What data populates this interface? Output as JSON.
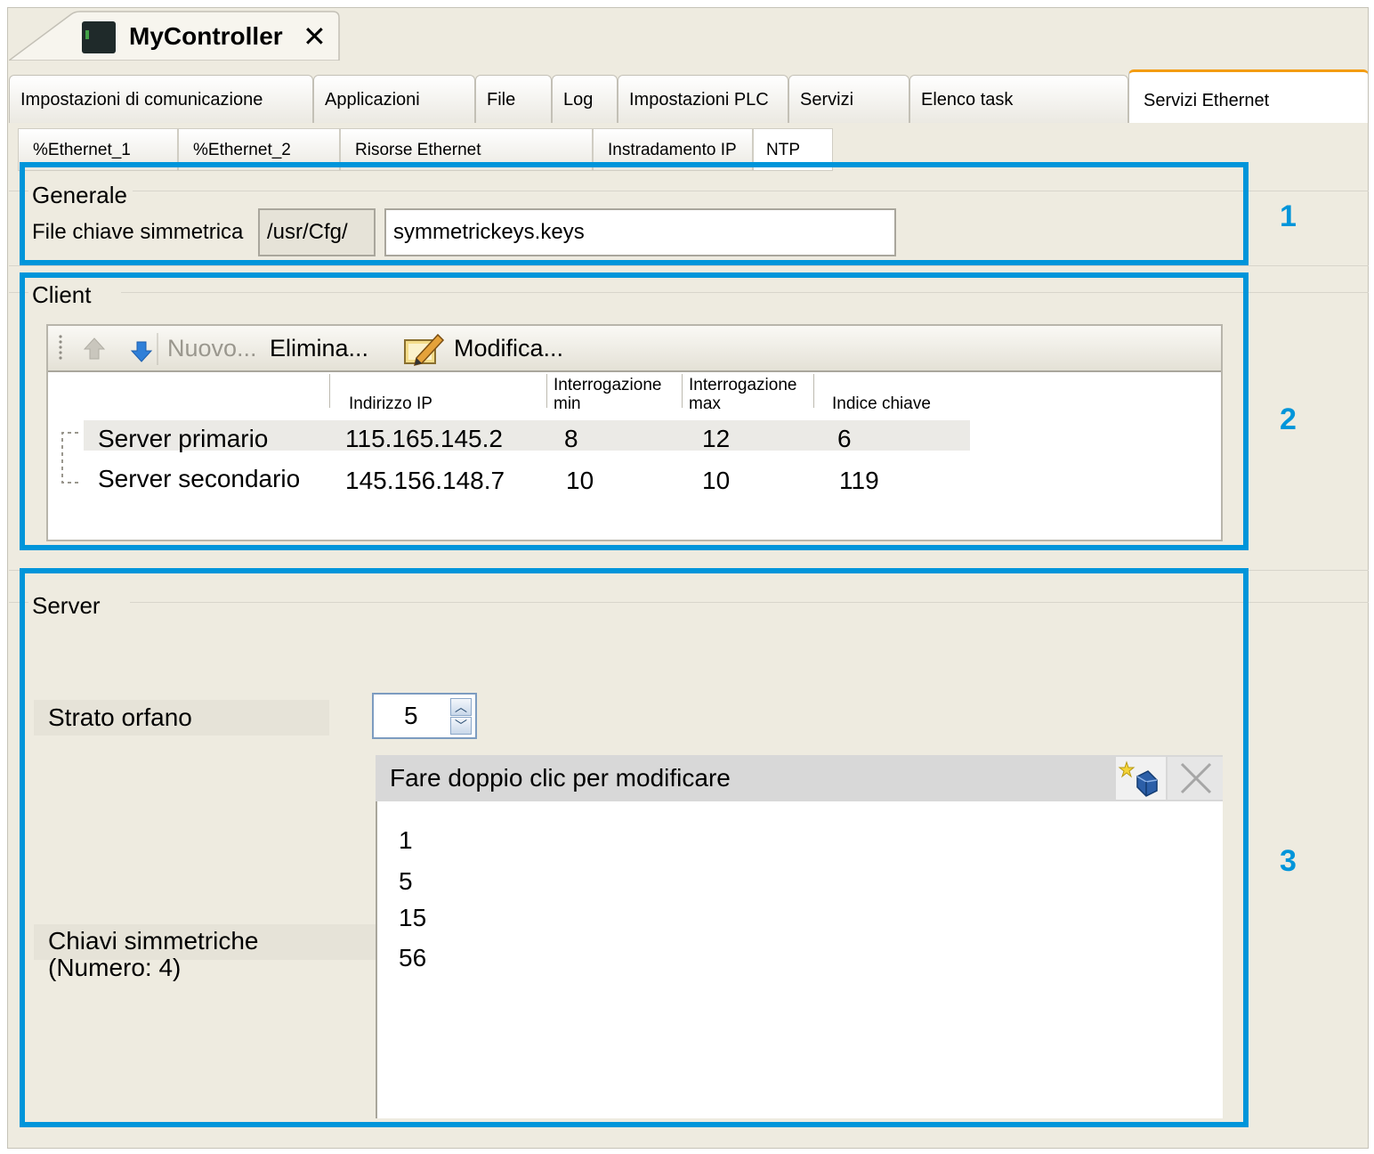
{
  "window": {
    "title": "MyController",
    "close_glyph": "✕",
    "icon": "controller-icon"
  },
  "main_tabs": [
    {
      "label": "Impostazioni di comunicazione"
    },
    {
      "label": "Applicazioni"
    },
    {
      "label": "File"
    },
    {
      "label": "Log"
    },
    {
      "label": "Impostazioni PLC"
    },
    {
      "label": "Servizi"
    },
    {
      "label": "Elenco task"
    },
    {
      "label": "Servizi Ethernet",
      "active": true
    }
  ],
  "sub_tabs": [
    {
      "label": "%Ethernet_1"
    },
    {
      "label": "%Ethernet_2"
    },
    {
      "label": "Risorse Ethernet"
    },
    {
      "label": "Instradamento IP"
    },
    {
      "label": "NTP",
      "active": true
    }
  ],
  "generale": {
    "title": "Generale",
    "file_label": "File chiave simmetrica",
    "path_prefix": "/usr/Cfg/",
    "file_value": "symmetrickeys.keys",
    "callout": "1"
  },
  "client": {
    "title": "Client",
    "callout": "2",
    "toolbar": {
      "new_label": "Nuovo...",
      "delete_label": "Elimina...",
      "edit_label": "Modifica...",
      "icons": [
        "move-up-icon",
        "move-down-icon",
        "edit-icon"
      ]
    },
    "columns": {
      "ip": "Indirizzo IP",
      "min_1": "Interrogazione",
      "min_2": "min",
      "max_1": "Interrogazione",
      "max_2": "max",
      "key": "Indice chiave"
    },
    "rows": [
      {
        "name": "Server primario",
        "ip": "115.165.145.2",
        "min": "8",
        "max": "12",
        "key": "6"
      },
      {
        "name": "Server secondario",
        "ip": "145.156.148.7",
        "min": "10",
        "max": "10",
        "key": "119"
      }
    ]
  },
  "server": {
    "title": "Server",
    "callout": "3",
    "orphan_label": "Strato orfano",
    "orphan_value": "5",
    "keys_header": "Fare doppio clic per modificare",
    "keys_label_1": "Chiavi simmetriche",
    "keys_label_2": "(Numero: 4)",
    "keys": [
      "1",
      "5",
      "15",
      "56"
    ]
  },
  "colors": {
    "accent_blue": "#0095da",
    "active_tab_orange": "#f39c12",
    "panel_bg": "#eeebe0"
  }
}
